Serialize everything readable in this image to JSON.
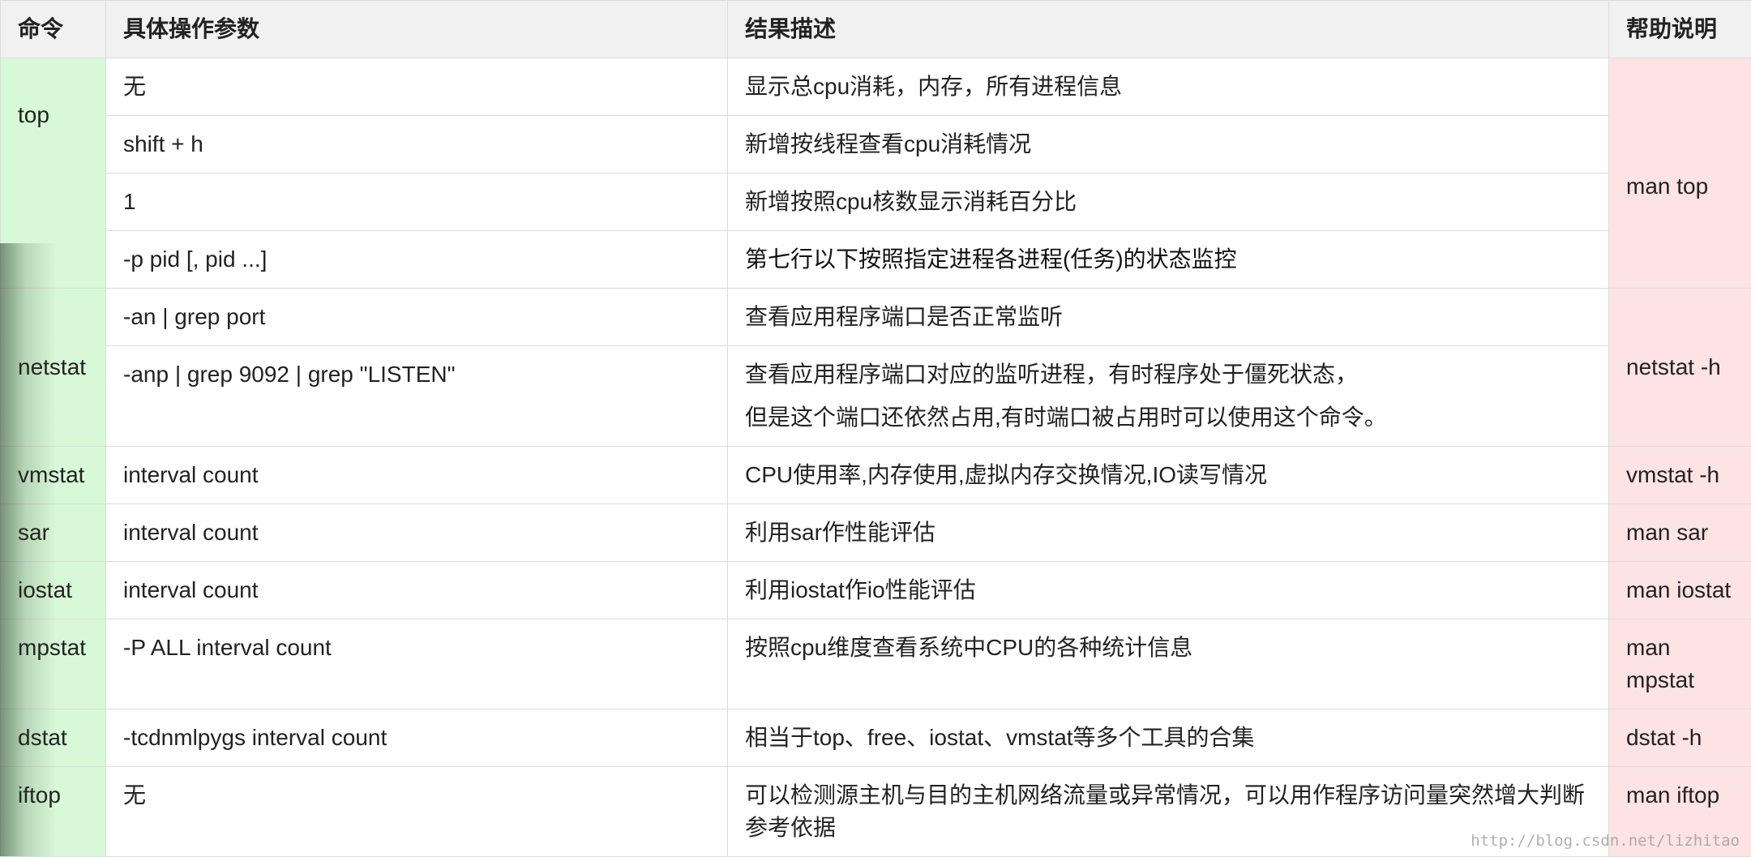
{
  "headers": {
    "command": "命令",
    "params": "具体操作参数",
    "result": "结果描述",
    "help": "帮助说明"
  },
  "groups": {
    "top": {
      "command": "top",
      "help": "man top",
      "rows": [
        {
          "params": "无",
          "result": "显示总cpu消耗，内存，所有进程信息"
        },
        {
          "params": "shift + h",
          "result": "新增按线程查看cpu消耗情况"
        },
        {
          "params": "1",
          "result": "新增按照cpu核数显示消耗百分比"
        },
        {
          "params": "-p pid [, pid ...]",
          "result": "第七行以下按照指定进程各进程(任务)的状态监控"
        }
      ]
    },
    "netstat": {
      "command": "netstat",
      "help": "netstat -h",
      "rows": [
        {
          "params": "-an | grep port",
          "result": "查看应用程序端口是否正常监听"
        },
        {
          "params": "-anp | grep 9092 | grep \"LISTEN\"",
          "result_line1": "查看应用程序端口对应的监听进程，有时程序处于僵死状态，",
          "result_line2": "但是这个端口还依然占用,有时端口被占用时可以使用这个命令。"
        }
      ]
    },
    "vmstat": {
      "command": "vmstat",
      "params": "interval count",
      "result": "CPU使用率,内存使用,虚拟内存交换情况,IO读写情况",
      "help": "vmstat -h"
    },
    "sar": {
      "command": "sar",
      "params": "interval count",
      "result": "利用sar作性能评估",
      "help": "man sar"
    },
    "iostat": {
      "command": "iostat",
      "params": "interval count",
      "result": "利用iostat作io性能评估",
      "help": "man iostat"
    },
    "mpstat": {
      "command": "mpstat",
      "params": "-P ALL interval count",
      "result": "按照cpu维度查看系统中CPU的各种统计信息",
      "help": "man mpstat"
    },
    "dstat": {
      "command": "dstat",
      "params": "-tcdnmlpygs interval count",
      "result": "相当于top、free、iostat、vmstat等多个工具的合集",
      "help": "dstat -h"
    },
    "iftop": {
      "command": "iftop",
      "params": "无",
      "result": "可以检测源主机与目的主机网络流量或异常情况，可以用作程序访问量突然增大判断参考依据",
      "help": "man iftop"
    }
  },
  "watermark": "http://blog.csdn.net/lizhitao",
  "colors": {
    "header_bg": "#f1f1f1",
    "command_bg": "#d8f9d8",
    "help_bg": "#fde3e4",
    "border": "#dcdcdc"
  }
}
